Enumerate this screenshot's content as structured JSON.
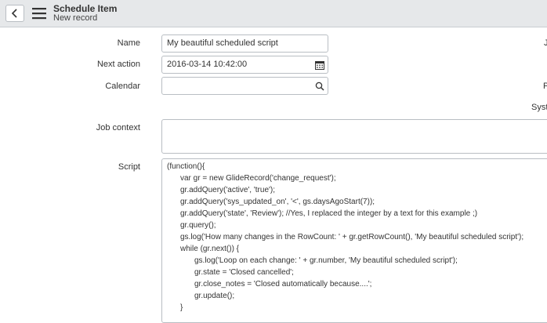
{
  "header": {
    "title": "Schedule Item",
    "subtitle": "New record"
  },
  "icons": {
    "back": "chevron-left-icon",
    "menu": "hamburger-menu-icon",
    "calendar": "calendar-icon",
    "search": "search-icon"
  },
  "form": {
    "name": {
      "label": "Name",
      "value": "My beautiful scheduled script"
    },
    "next_action": {
      "label": "Next action",
      "value": "2016-03-14 10:42:00"
    },
    "calendar": {
      "label": "Calendar",
      "value": ""
    },
    "job_context": {
      "label": "Job context",
      "value": ""
    },
    "script": {
      "label": "Script",
      "lines": [
        "(function(){",
        "var gr = new GlideRecord('change_request');",
        "gr.addQuery('active', 'true');",
        "gr.addQuery('sys_updated_on', '<', gs.daysAgoStart(7));",
        "gr.addQuery('state', 'Review'); //Yes, I replaced the integer by a text for this example ;)",
        "gr.query();",
        "gs.log('How many changes in the RowCount: ' + gr.getRowCount(), 'My beautiful scheduled script');",
        "while (gr.next()) {",
        "gs.log('Loop on each change: ' + gr.number, 'My beautiful scheduled script');",
        "gr.state = 'Closed cancelled';",
        "gr.close_notes = 'Closed automatically because....';",
        "gr.update();",
        "}"
      ]
    }
  },
  "right_column": {
    "label_1": "J",
    "label_2": "P",
    "label_3": "Syst"
  }
}
